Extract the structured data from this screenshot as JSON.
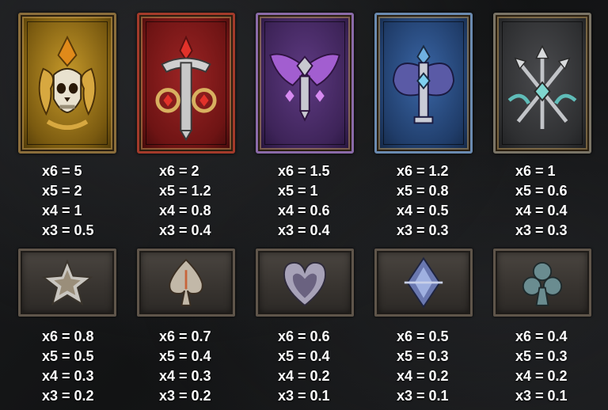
{
  "symbols": [
    {
      "name": "gold-skull",
      "frame": "#b8902f",
      "bg": "#7a5a10",
      "accent": "#d9a838",
      "pays": [
        "x6 = 5",
        "x5 = 2",
        "x4 = 1",
        "x3 = 0.5"
      ]
    },
    {
      "name": "red-sword",
      "frame": "#9c2a2a",
      "bg": "#6e1414",
      "accent": "#d83a2a",
      "pays": [
        "x6 = 2",
        "x5 = 1.2",
        "x4 = 0.8",
        "x3 = 0.4"
      ]
    },
    {
      "name": "purple-winged-sword",
      "frame": "#7b5a9a",
      "bg": "#3e2459",
      "accent": "#b06ad8",
      "pays": [
        "x6 = 1.5",
        "x5 = 1",
        "x4 = 0.6",
        "x3 = 0.4"
      ]
    },
    {
      "name": "blue-axe",
      "frame": "#4f6f99",
      "bg": "#203d6a",
      "accent": "#7aa0d8",
      "pays": [
        "x6 = 1.2",
        "x5 = 0.8",
        "x4 = 0.5",
        "x3 = 0.3"
      ]
    },
    {
      "name": "grey-arrows",
      "frame": "#6d6d6d",
      "bg": "#2e2f31",
      "accent": "#6fc4c0",
      "pays": [
        "x6 = 1",
        "x5 = 0.6",
        "x4 = 0.4",
        "x3 = 0.3"
      ]
    }
  ],
  "low_symbols": [
    {
      "name": "star",
      "pays": [
        "x6 = 0.8",
        "x5 = 0.5",
        "x4 = 0.3",
        "x3 = 0.2"
      ]
    },
    {
      "name": "spade",
      "pays": [
        "x6 = 0.7",
        "x5 = 0.4",
        "x4 = 0.3",
        "x3 = 0.2"
      ]
    },
    {
      "name": "heart",
      "pays": [
        "x6 = 0.6",
        "x5 = 0.4",
        "x4 = 0.2",
        "x3 = 0.1"
      ]
    },
    {
      "name": "diamond",
      "pays": [
        "x6 = 0.5",
        "x5 = 0.3",
        "x4 = 0.2",
        "x3 = 0.1"
      ]
    },
    {
      "name": "club",
      "pays": [
        "x6 = 0.4",
        "x5 = 0.3",
        "x4 = 0.2",
        "x3 = 0.1"
      ]
    }
  ]
}
